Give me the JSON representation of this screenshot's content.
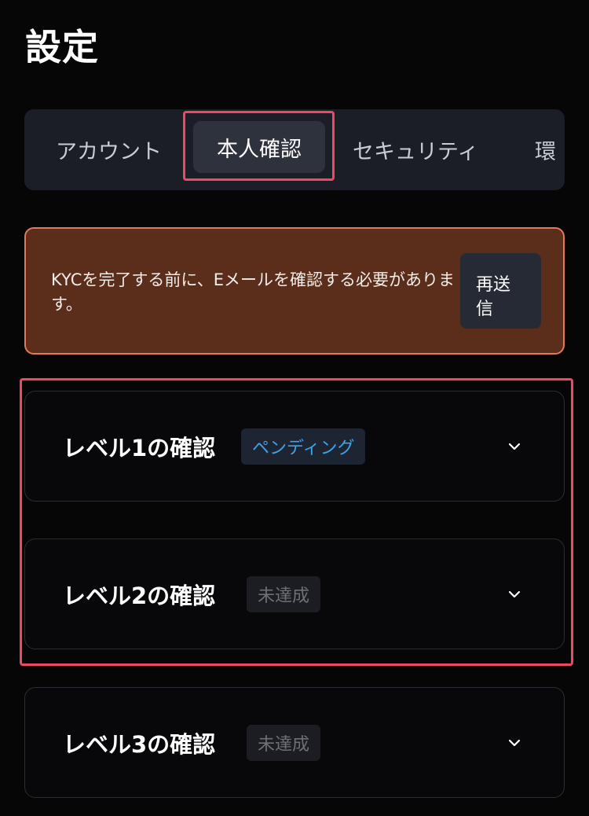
{
  "header": {
    "title": "設定"
  },
  "tabs": [
    {
      "label": "アカウント"
    },
    {
      "label": "本人確認",
      "active": true
    },
    {
      "label": "セキュリティ"
    },
    {
      "label": "環"
    }
  ],
  "alert": {
    "message": "KYCを完了する前に、Eメールを確認する必要があります。",
    "resend_label": "再送信"
  },
  "levels": [
    {
      "title": "レベル1の確認",
      "status": "ペンディング"
    },
    {
      "title": "レベル2の確認",
      "status": "未達成"
    },
    {
      "title": "レベル3の確認",
      "status": "未達成"
    }
  ],
  "colors": {
    "background": "#060607",
    "accent_highlight": "#ef4865",
    "alert_bg": "#5b2d1b",
    "alert_border": "#e07a5a",
    "pending": "#3ea3e8"
  },
  "icons": {
    "expand": "chevron-down-icon"
  }
}
